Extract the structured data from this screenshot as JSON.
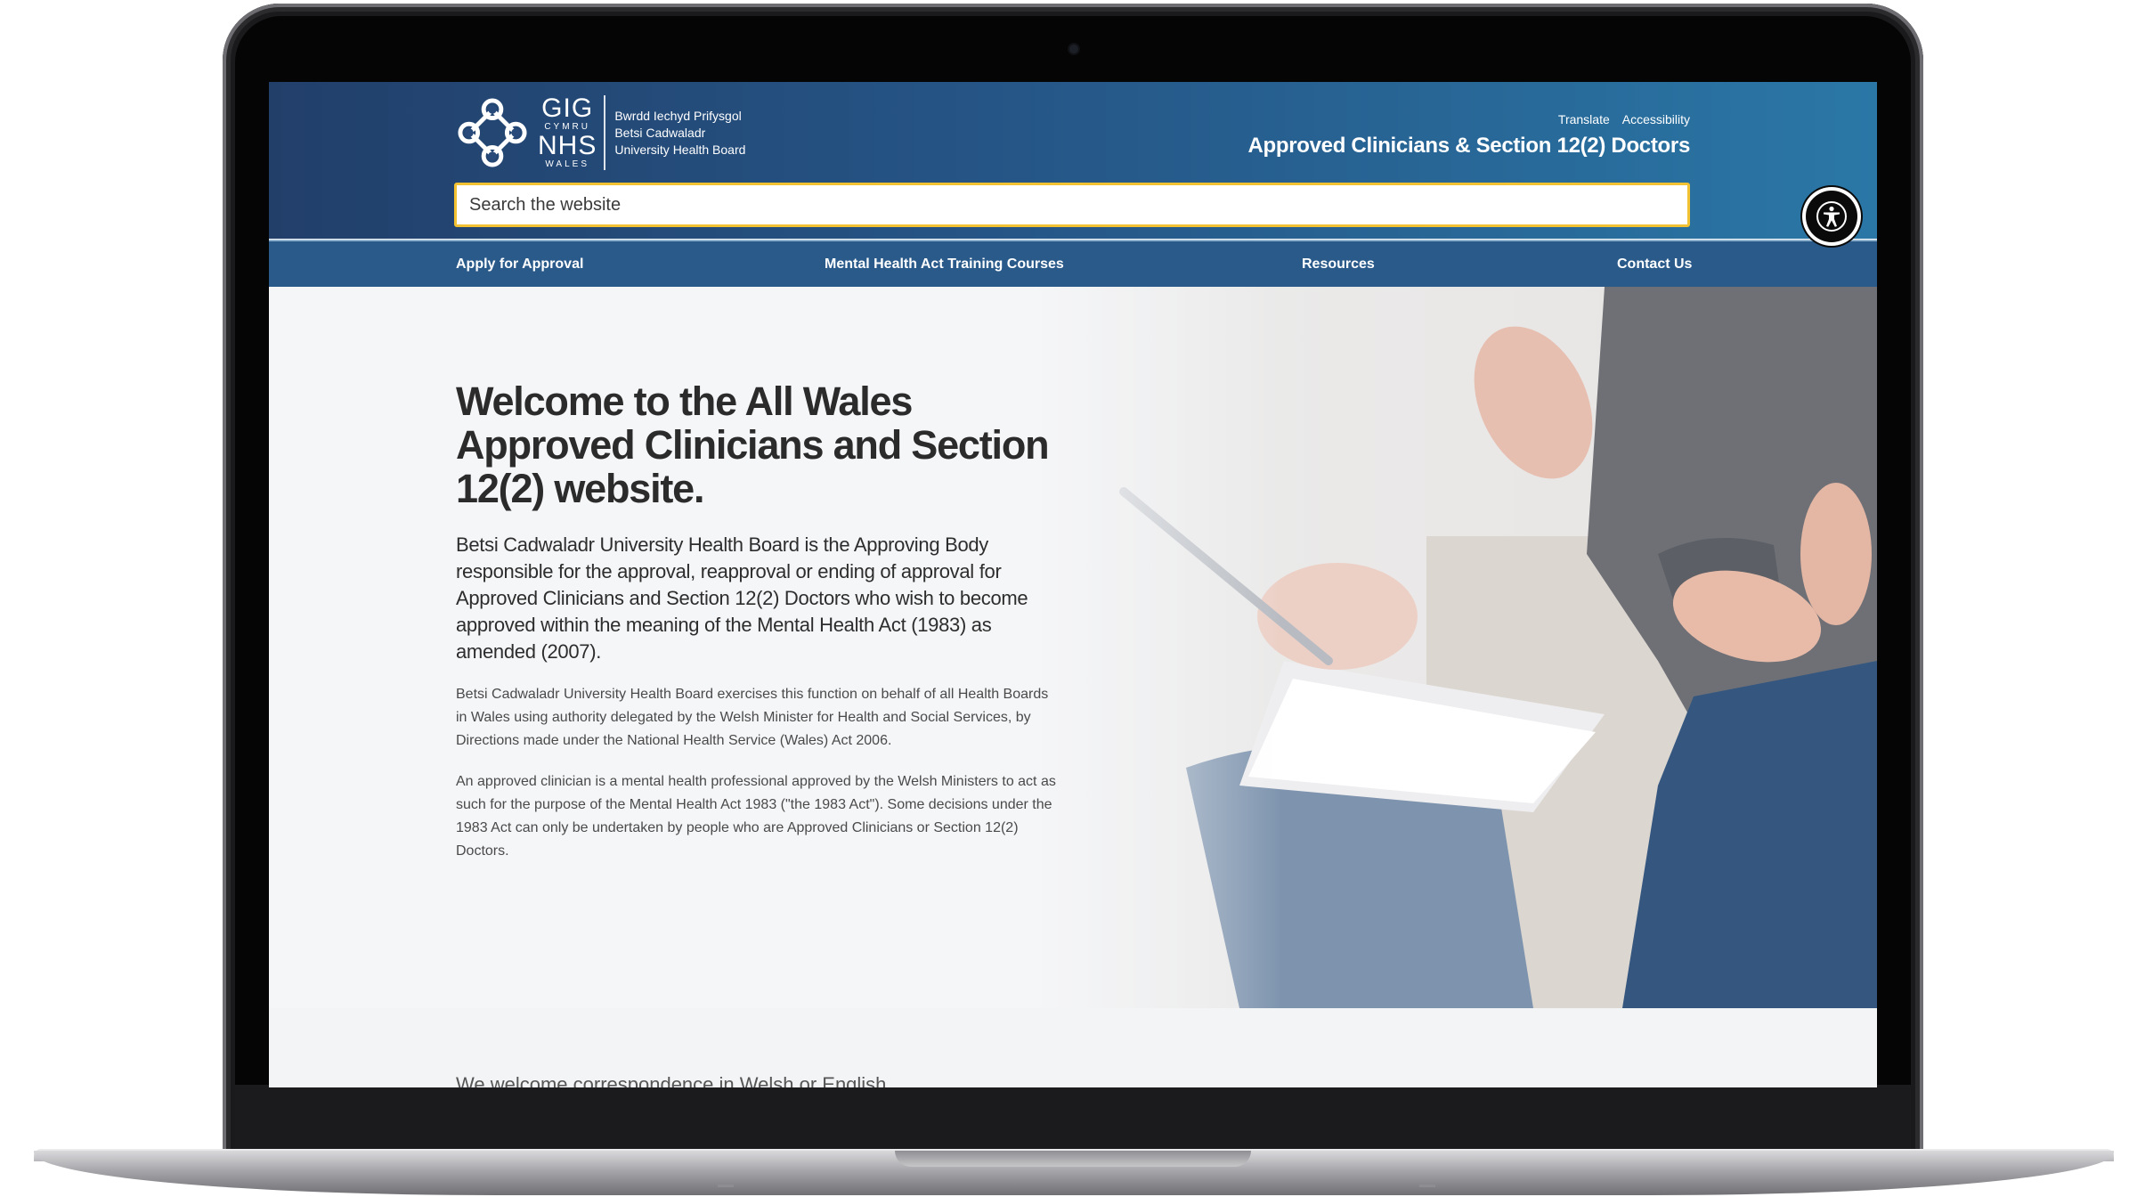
{
  "header": {
    "logo_text": {
      "gig": "GIG",
      "cymru": "CYMRU",
      "nhs": "NHS",
      "wales": "WALES"
    },
    "org_names": [
      "Bwrdd Iechyd Prifysgol",
      "Betsi Cadwaladr",
      "University Health Board"
    ],
    "util_links": [
      "Translate",
      "Accessibility"
    ],
    "site_title": "Approved Clinicians & Section 12(2) Doctors",
    "search_placeholder": "Search the website"
  },
  "nav": {
    "items": [
      "Apply for Approval",
      "Mental Health Act Training Courses",
      "Resources",
      "Contact Us"
    ]
  },
  "hero": {
    "title_lines": [
      "Welcome to the All Wales",
      "Approved Clinicians and Section",
      "12(2) website."
    ],
    "lead": "Betsi Cadwaladr University Health Board is the Approving Body responsible for the approval, reapproval or ending of approval for Approved Clinicians and Section 12(2) Doctors who wish to become approved within the meaning of the Mental Health Act (1983) as amended (2007).",
    "para1": "Betsi Cadwaladr University Health Board exercises this function on behalf of all Health Boards in Wales using authority delegated by the Welsh Minister for Health and Social Services, by Directions made under the National Health Service (Wales) Act 2006.",
    "para2": "An approved clinician is a mental health professional approved by the Welsh Ministers to act as such for the purpose of the Mental Health Act 1983 (\"the 1983 Act\"). Some decisions under the 1983 Act can only be undertaken by people who are Approved Clinicians or Section 12(2) Doctors."
  },
  "below": {
    "partial_text": "We welcome correspondence in Welsh or English"
  },
  "icons": {
    "logo": "nhs-wales-knot-icon",
    "accessibility": "accessibility-person-icon"
  },
  "colors": {
    "header_start": "#223f6a",
    "header_end": "#2a77a6",
    "nav": "#2a5a8a",
    "search_border": "#f2c233",
    "title_text": "#2b2b2b"
  }
}
